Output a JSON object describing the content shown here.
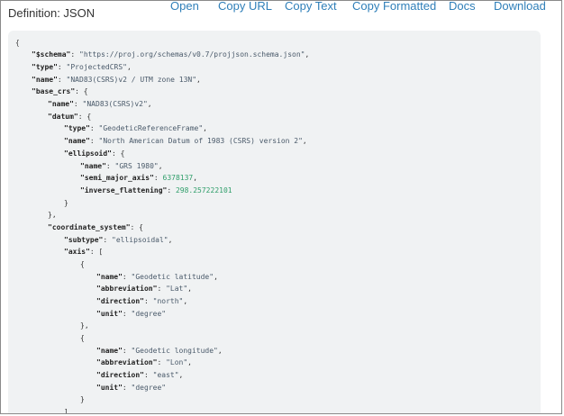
{
  "header": {
    "title": "Definition: JSON"
  },
  "toolbar": {
    "open": "Open",
    "copy_url": "Copy URL",
    "copy_text": "Copy Text",
    "copy_formatted": "Copy Formatted",
    "docs": "Docs",
    "download": "Download"
  },
  "colors": {
    "link": "#2f7fb9",
    "code_bg": "#f0f2f3",
    "number": "#2f9e6a",
    "key": "#222222"
  },
  "code": {
    "open_brace": "{",
    "schema_key": "\"$schema\"",
    "schema_val": "\"https://proj.org/schemas/v0.7/projjson.schema.json\"",
    "type_key": "\"type\"",
    "type_val": "\"ProjectedCRS\"",
    "name_key": "\"name\"",
    "name_val": "\"NAD83(CSRS)v2 / UTM zone 13N\"",
    "base_crs_key": "\"base_crs\"",
    "base_name_key": "\"name\"",
    "base_name_val": "\"NAD83(CSRS)v2\"",
    "datum_key": "\"datum\"",
    "datum_type_key": "\"type\"",
    "datum_type_val": "\"GeodeticReferenceFrame\"",
    "datum_name_key": "\"name\"",
    "datum_name_val": "\"North American Datum of 1983 (CSRS) version 2\"",
    "ellipsoid_key": "\"ellipsoid\"",
    "ell_name_key": "\"name\"",
    "ell_name_val": "\"GRS 1980\"",
    "sma_key": "\"semi_major_axis\"",
    "sma_val": "6378137",
    "invf_key": "\"inverse_flattening\"",
    "invf_val": "298.257222101",
    "cs_key": "\"coordinate_system\"",
    "subtype_key": "\"subtype\"",
    "subtype_val": "\"ellipsoidal\"",
    "axis_key": "\"axis\"",
    "ax1_name_key": "\"name\"",
    "ax1_name_val": "\"Geodetic latitude\"",
    "ax1_abbr_key": "\"abbreviation\"",
    "ax1_abbr_val": "\"Lat\"",
    "ax1_dir_key": "\"direction\"",
    "ax1_dir_val": "\"north\"",
    "ax1_unit_key": "\"unit\"",
    "ax1_unit_val": "\"degree\"",
    "ax2_name_key": "\"name\"",
    "ax2_name_val": "\"Geodetic longitude\"",
    "ax2_abbr_key": "\"abbreviation\"",
    "ax2_abbr_val": "\"Lon\"",
    "ax2_dir_key": "\"direction\"",
    "ax2_dir_val": "\"east\"",
    "ax2_unit_key": "\"unit\"",
    "ax2_unit_val": "\"degree\""
  }
}
